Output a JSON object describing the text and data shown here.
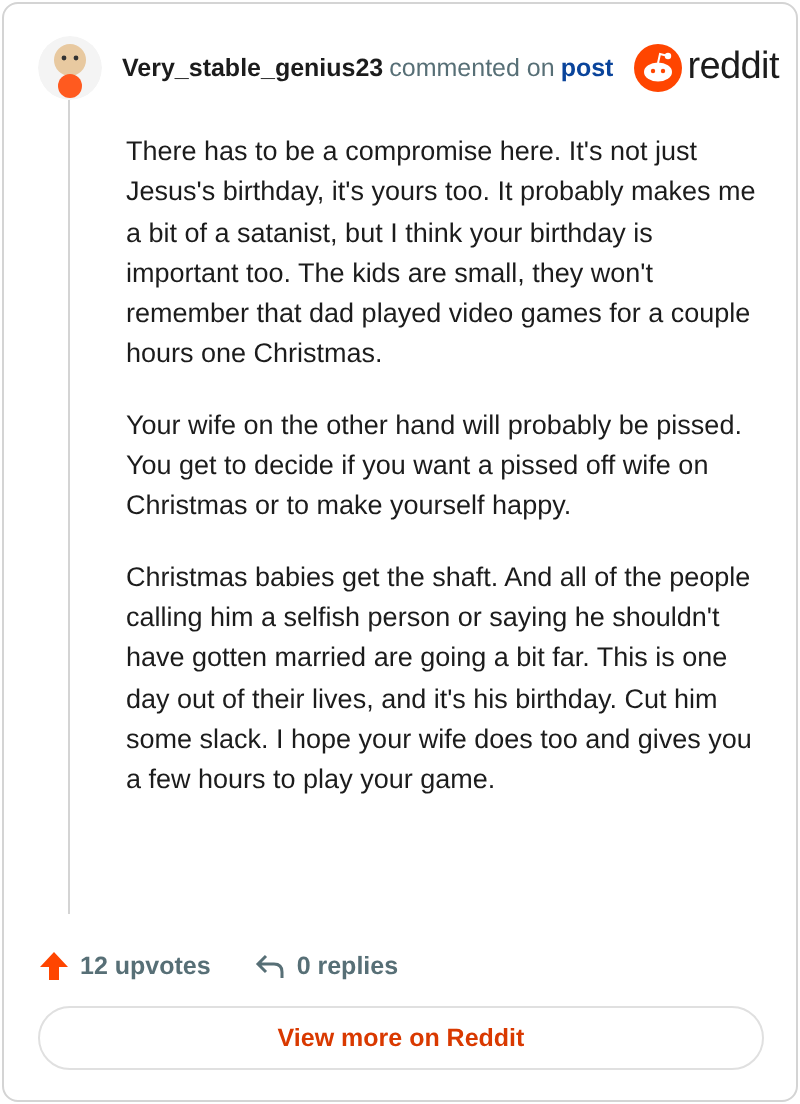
{
  "comment": {
    "author": "Very_stable_genius23",
    "action": "commented on",
    "link": "post"
  },
  "brand": "reddit",
  "paragraphs": [
    "There has to be a compromise here. It's not just Jesus's birthday, it's yours too. It probably makes me a bit of a satanist, but I think your birthday is important too. The kids are small, they won't remember that dad played video games for a couple hours one Christmas.",
    "Your wife on the other hand will probably be pissed. You get to decide if you want a pissed off wife on Christmas or to make yourself happy.",
    "Christmas babies get the shaft. And all of the people calling him a selfish person or saying he shouldn't have gotten married are going a bit far. This is one day out of their lives, and it's his birthday. Cut him some slack. I hope your wife does too and gives you a few hours to play your game."
  ],
  "footer": {
    "upvotes": "12 upvotes",
    "replies": "0 replies"
  },
  "button": "View more on Reddit"
}
